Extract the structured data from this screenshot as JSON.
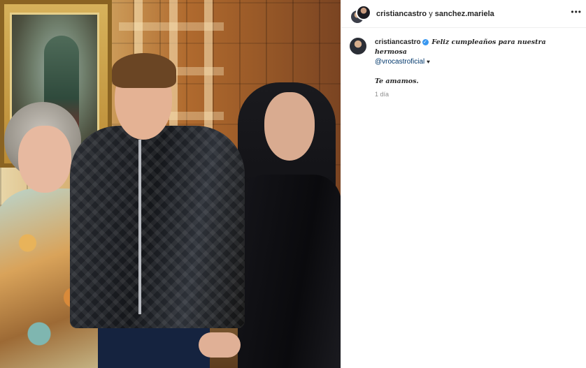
{
  "header": {
    "user1": "cristiancastro",
    "connector": "y",
    "user2": "sanchez.mariela",
    "more_icon": "more-horizontal-icon"
  },
  "caption": {
    "username": "cristiancastro",
    "verified_icon": "verified-badge-icon",
    "text": "Feliz cumpleaños para nuestra hermosa",
    "mention": "@vrocastroficial",
    "heart": "♥",
    "line2": "Te amamos.",
    "timestamp": "1 día"
  },
  "colors": {
    "link": "#00376b",
    "verified": "#3897f0",
    "muted": "#8e8e8e"
  }
}
